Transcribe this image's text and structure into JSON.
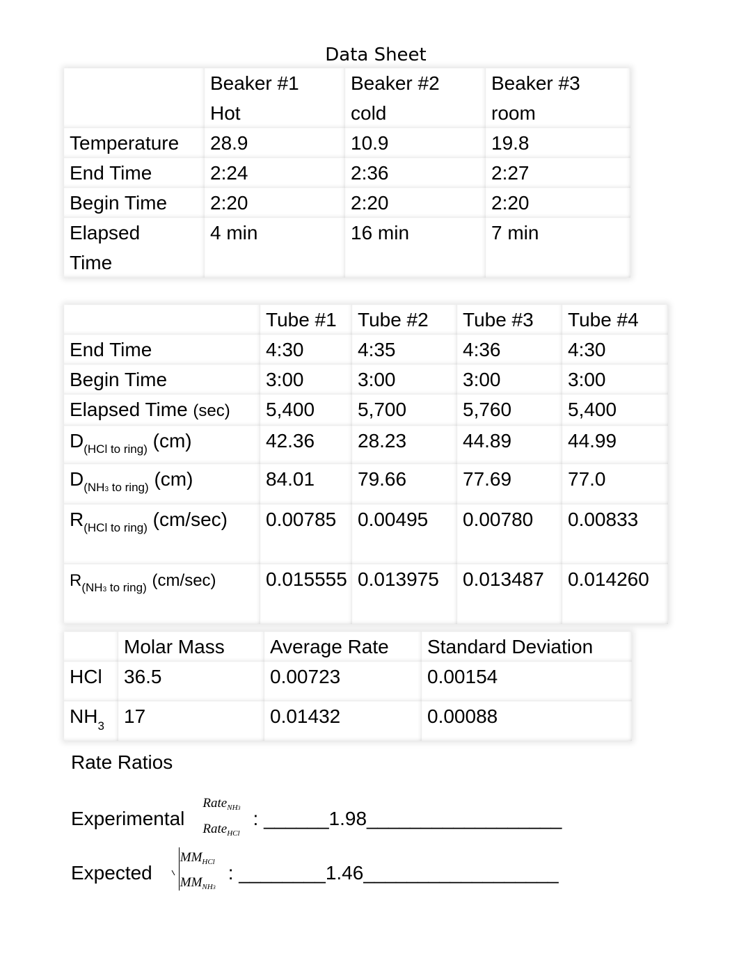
{
  "title": "Data Sheet",
  "beaker_table": {
    "headers": [
      {
        "line1": "",
        "line2": ""
      },
      {
        "line1": "Beaker #1",
        "line2": "Hot"
      },
      {
        "line1": "Beaker #2",
        "line2": "cold"
      },
      {
        "line1": "Beaker #3",
        "line2": "room"
      }
    ],
    "rows": [
      {
        "label": "Temperature",
        "values": [
          "28.9",
          "10.9",
          "19.8"
        ]
      },
      {
        "label": "End Time",
        "values": [
          "2:24",
          "2:36",
          "2:27"
        ]
      },
      {
        "label": "Begin Time",
        "values": [
          "2:20",
          "2:20",
          "2:20"
        ]
      },
      {
        "label": "Elapsed Time",
        "values": [
          "4 min",
          "16 min",
          "7 min"
        ]
      }
    ]
  },
  "tube_table": {
    "headers": [
      "",
      "Tube #1",
      "Tube #2",
      "Tube #3",
      "Tube #4"
    ],
    "rows": [
      {
        "label": "End Time",
        "values": [
          "4:30",
          "4:35",
          "4:36",
          "4:30"
        ]
      },
      {
        "label": "Begin Time",
        "values": [
          "3:00",
          "3:00",
          "3:00",
          "3:00"
        ]
      },
      {
        "label": "Elapsed Time",
        "unit": "(sec)",
        "values": [
          "5,400",
          "5,700",
          "5,760",
          "5,400"
        ]
      },
      {
        "label": "D",
        "subscript": "(HCl to ring)",
        "unit": "(cm)",
        "values": [
          "42.36",
          "28.23",
          "44.89",
          "44.99"
        ]
      },
      {
        "label": "D",
        "subscript_pre": "(NH",
        "subscript_num": "3",
        "subscript_post": " to ring)",
        "unit": "(cm)",
        "values": [
          "84.01",
          "79.66",
          "77.69",
          "77.0"
        ]
      },
      {
        "label": "R",
        "subscript": "(HCl to ring)",
        "unit": "(cm/sec)",
        "values": [
          "0.00785",
          "0.00495",
          "0.00780",
          "0.00833"
        ]
      },
      {
        "label": "R",
        "subscript_pre": "(NH",
        "subscript_num": "3",
        "subscript_post": " to ring)",
        "unit": "(cm/sec)",
        "values": [
          "0.015555",
          "0.013975",
          "0.013487",
          "0.014260"
        ]
      }
    ]
  },
  "summary_table": {
    "headers": [
      "",
      "Molar Mass",
      "Average Rate",
      "Standard Deviation"
    ],
    "rows": [
      {
        "label": "HCl",
        "label_sub": "",
        "values": [
          "36.5",
          "0.00723",
          "0.00154"
        ]
      },
      {
        "label": "NH",
        "label_sub": "3",
        "values": [
          "17",
          "0.01432",
          "0.00088"
        ]
      }
    ]
  },
  "rate_ratios": {
    "heading": "Rate Ratios",
    "experimental": {
      "label": "Experimental",
      "numerator": "Rate",
      "numerator_sub": "NH",
      "numerator_sub_num": "3",
      "denominator": "Rate",
      "denominator_sub": "HCl",
      "colon": ":",
      "blank_before": "______",
      "value": "1.98",
      "blank_after": "__________________"
    },
    "expected": {
      "label": "Expected",
      "numerator": "MM",
      "numerator_sub": "HCl",
      "denominator": "MM",
      "denominator_sub": "NH",
      "denominator_sub_num": "3",
      "colon": ":",
      "blank_before": "________",
      "value": "1.46",
      "blank_after": "__________________"
    }
  }
}
